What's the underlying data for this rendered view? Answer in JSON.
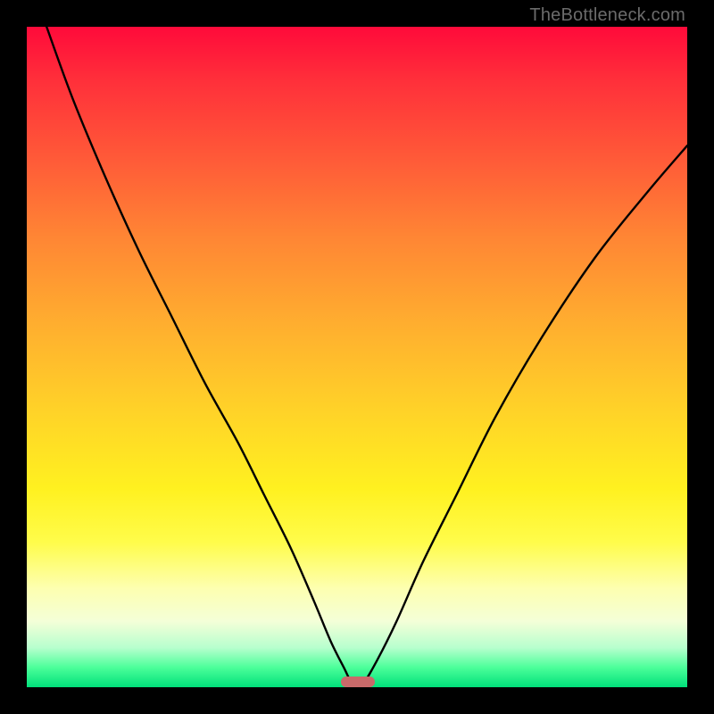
{
  "watermark": "TheBottleneck.com",
  "chart_data": {
    "type": "line",
    "title": "",
    "xlabel": "",
    "ylabel": "",
    "xlim": [
      0,
      100
    ],
    "ylim": [
      0,
      100
    ],
    "grid": false,
    "legend": false,
    "series": [
      {
        "name": "curve",
        "x": [
          3,
          7,
          12,
          17,
          22,
          27,
          32,
          36,
          40,
          43.5,
          46,
          48,
          49.4,
          50.8,
          53,
          56,
          60,
          65,
          71,
          78,
          86,
          94,
          100
        ],
        "values": [
          100,
          89,
          77,
          66,
          56,
          46,
          37,
          29,
          21,
          13,
          7,
          3,
          0.4,
          0.4,
          4,
          10,
          19,
          29,
          41,
          53,
          65,
          75,
          82
        ]
      }
    ],
    "marker": {
      "x_center": 50.1,
      "width_pct": 5.2,
      "height_pct": 1.6
    },
    "gradient_stops": [
      {
        "pct": 0,
        "color": "#ff0a3a"
      },
      {
        "pct": 20,
        "color": "#ff5a38"
      },
      {
        "pct": 45,
        "color": "#ffae2f"
      },
      {
        "pct": 70,
        "color": "#fff120"
      },
      {
        "pct": 90,
        "color": "#f4ffd8"
      },
      {
        "pct": 100,
        "color": "#00e07a"
      }
    ]
  }
}
